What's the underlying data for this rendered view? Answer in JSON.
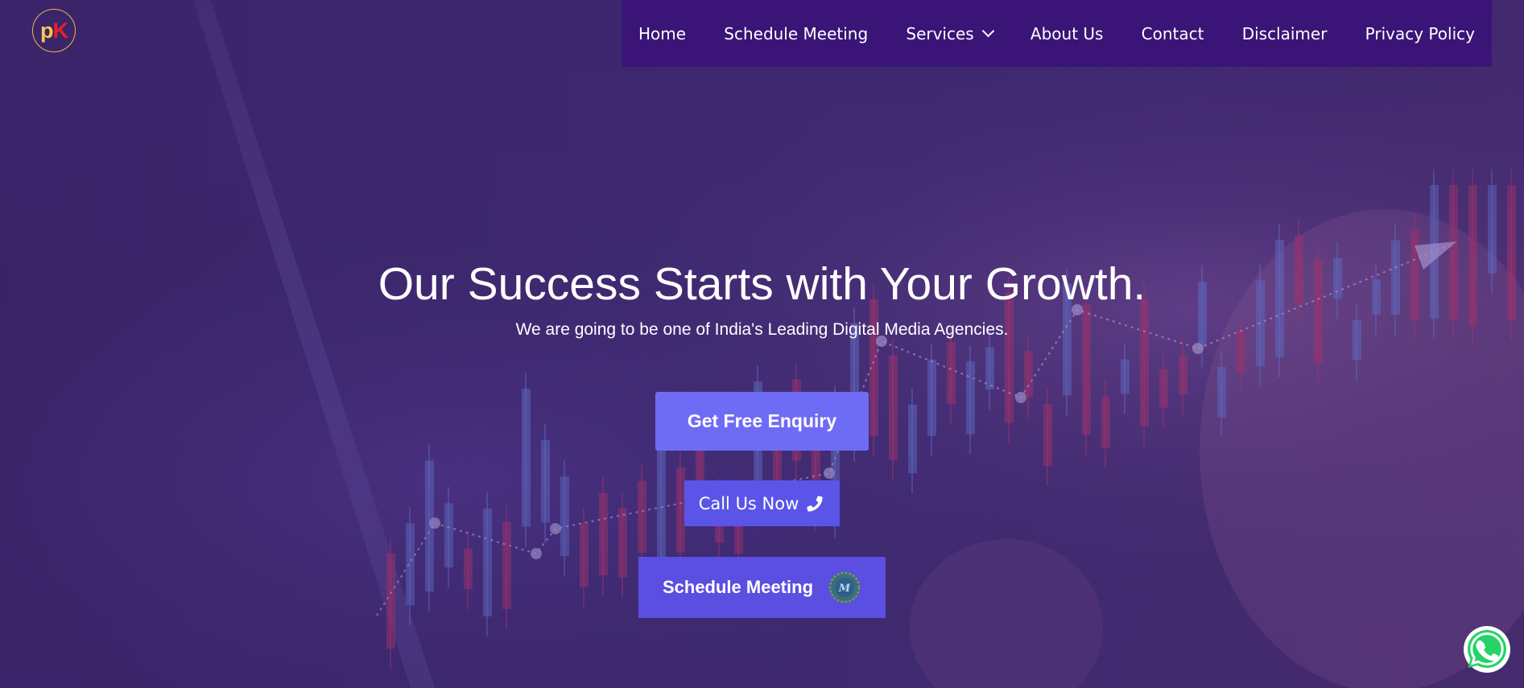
{
  "brand": {
    "logo_p": "p",
    "logo_k": "K",
    "logo_colors": {
      "p": "#f2c94c",
      "k": "#e8202a",
      "ring": "#e8b64a"
    }
  },
  "nav": {
    "items": [
      {
        "label": "Home"
      },
      {
        "label": "Schedule Meeting"
      },
      {
        "label": "Services",
        "has_dropdown": true
      },
      {
        "label": "About Us"
      },
      {
        "label": "Contact"
      },
      {
        "label": "Disclaimer"
      },
      {
        "label": "Privacy Policy"
      }
    ],
    "background": "#3a1577"
  },
  "hero": {
    "headline": "Our Success Starts with Your Growth.",
    "subheadline": "We are going to be one of India's Leading Digital Media Agencies.",
    "buttons": {
      "enquiry": "Get Free Enquiry",
      "call": "Call Us Now",
      "meeting": "Schedule Meeting"
    },
    "colors": {
      "enquiry": "#6e6cf4",
      "call": "#5a55e6",
      "meeting": "#5a4fe0"
    }
  },
  "icons": {
    "call": "phone-icon",
    "meeting": "meeting-logo-icon",
    "chat": "whatsapp-icon",
    "dropdown": "chevron-down-icon"
  }
}
